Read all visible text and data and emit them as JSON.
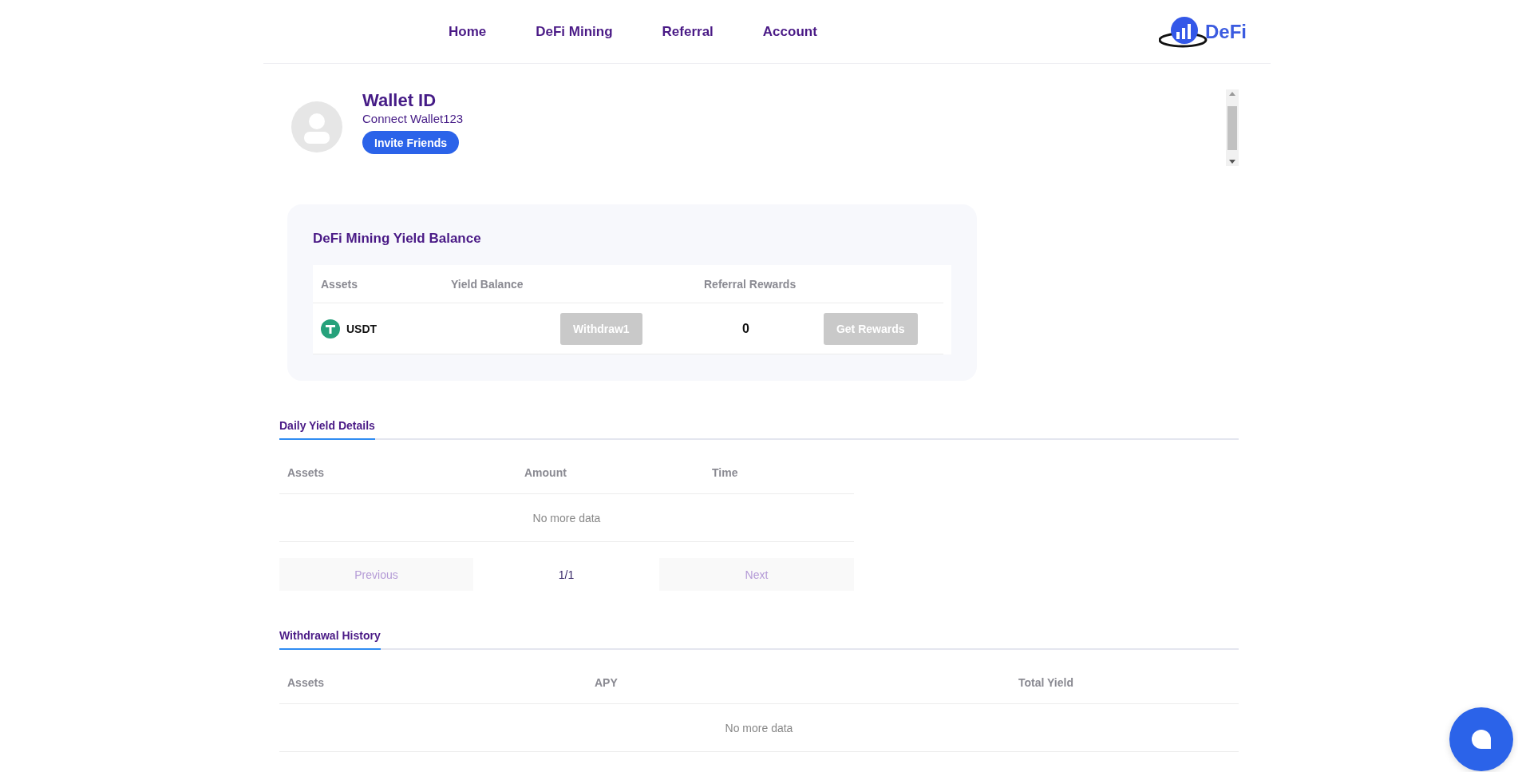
{
  "nav": {
    "items": [
      {
        "label": "Home"
      },
      {
        "label": "DeFi Mining"
      },
      {
        "label": "Referral"
      },
      {
        "label": "Account"
      }
    ],
    "logo_text": "DeFi"
  },
  "profile": {
    "title": "Wallet ID",
    "subtitle": "Connect Wallet123",
    "invite_button": "Invite Friends"
  },
  "balance_card": {
    "title": "DeFi Mining Yield Balance",
    "columns": [
      "Assets",
      "Yield Balance",
      "Referral Rewards"
    ],
    "rows": [
      {
        "asset": "USDT",
        "withdraw_button": {
          "label": "Withdraw1",
          "disabled": true
        },
        "referral_rewards": "0",
        "rewards_button": {
          "label": "Get Rewards",
          "disabled": true
        }
      }
    ]
  },
  "daily_yield": {
    "tab": {
      "label": "Daily Yield Details",
      "selected": true
    },
    "columns": [
      "Assets",
      "Amount",
      "Time"
    ],
    "empty_text": "No more data",
    "pagination": {
      "previous": {
        "label": "Previous",
        "disabled": true
      },
      "page": "1/1",
      "next": {
        "label": "Next",
        "disabled": true
      }
    }
  },
  "withdrawal_history": {
    "tab": {
      "label": "Withdrawal History",
      "selected": true
    },
    "columns": [
      "Assets",
      "APY",
      "Total Yield"
    ],
    "empty_text": "No more data"
  }
}
